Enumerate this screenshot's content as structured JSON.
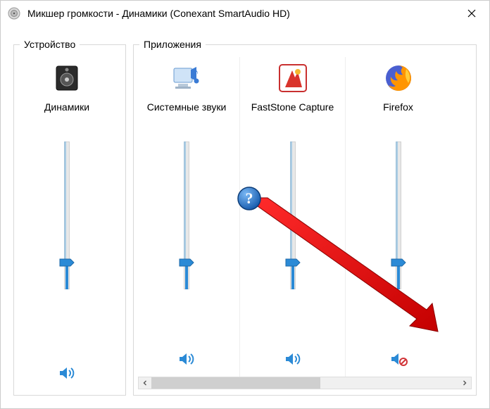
{
  "window": {
    "title": "Микшер громкости - Динамики (Conexant SmartAudio HD)",
    "close_glyph": "✕"
  },
  "device_group": {
    "legend": "Устройство"
  },
  "apps_group": {
    "legend": "Приложения"
  },
  "colors": {
    "accent": "#2b8ad6",
    "muted_red": "#d13438"
  },
  "channels": [
    {
      "id": "device-speakers",
      "icon": "speaker-device-icon",
      "label": "Динамики",
      "volume": 18,
      "peak": 0,
      "muted": false,
      "group": "device"
    },
    {
      "id": "app-system-sounds",
      "icon": "system-sounds-icon",
      "label": "Системные звуки",
      "volume": 18,
      "peak": 0,
      "muted": false,
      "group": "apps"
    },
    {
      "id": "app-faststone",
      "icon": "faststone-icon",
      "label": "FastStone Capture",
      "volume": 18,
      "peak": 0,
      "muted": false,
      "group": "apps"
    },
    {
      "id": "app-firefox",
      "icon": "firefox-icon",
      "label": "Firefox",
      "volume": 18,
      "peak": 0,
      "muted": true,
      "group": "apps"
    }
  ],
  "scroll": {
    "left_glyph": "◀",
    "right_glyph": "▶"
  },
  "annotation": {
    "help_glyph": "?"
  }
}
